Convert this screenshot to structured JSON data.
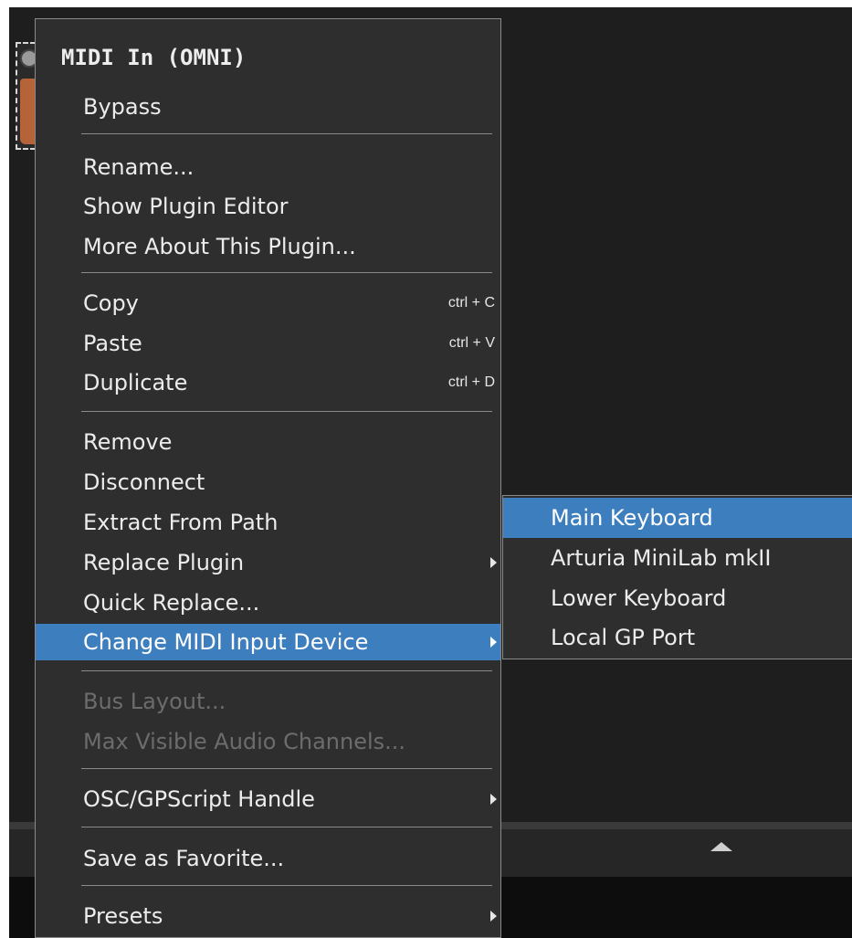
{
  "menu": {
    "header": "MIDI In (OMNI)",
    "items": [
      {
        "label": "Bypass"
      },
      {
        "label": "Rename..."
      },
      {
        "label": "Show Plugin Editor"
      },
      {
        "label": "More About This Plugin..."
      },
      {
        "label": "Copy",
        "shortcut": "ctrl + C"
      },
      {
        "label": "Paste",
        "shortcut": "ctrl + V"
      },
      {
        "label": "Duplicate",
        "shortcut": "ctrl + D"
      },
      {
        "label": "Remove"
      },
      {
        "label": "Disconnect"
      },
      {
        "label": "Extract From Path"
      },
      {
        "label": "Replace Plugin"
      },
      {
        "label": "Quick Replace..."
      },
      {
        "label": "Change MIDI Input Device"
      },
      {
        "label": "Bus Layout..."
      },
      {
        "label": "Max Visible Audio Channels..."
      },
      {
        "label": "OSC/GPScript Handle"
      },
      {
        "label": "Save as Favorite..."
      },
      {
        "label": "Presets"
      }
    ]
  },
  "submenu": {
    "items": [
      {
        "label": "Main Keyboard"
      },
      {
        "label": "Arturia MiniLab mkII"
      },
      {
        "label": "Lower Keyboard"
      },
      {
        "label": "Local GP Port"
      }
    ]
  },
  "colors": {
    "highlight": "#3d7ebf",
    "menu_bg": "#2e2e2e",
    "disabled_text": "#6c6c6c"
  }
}
